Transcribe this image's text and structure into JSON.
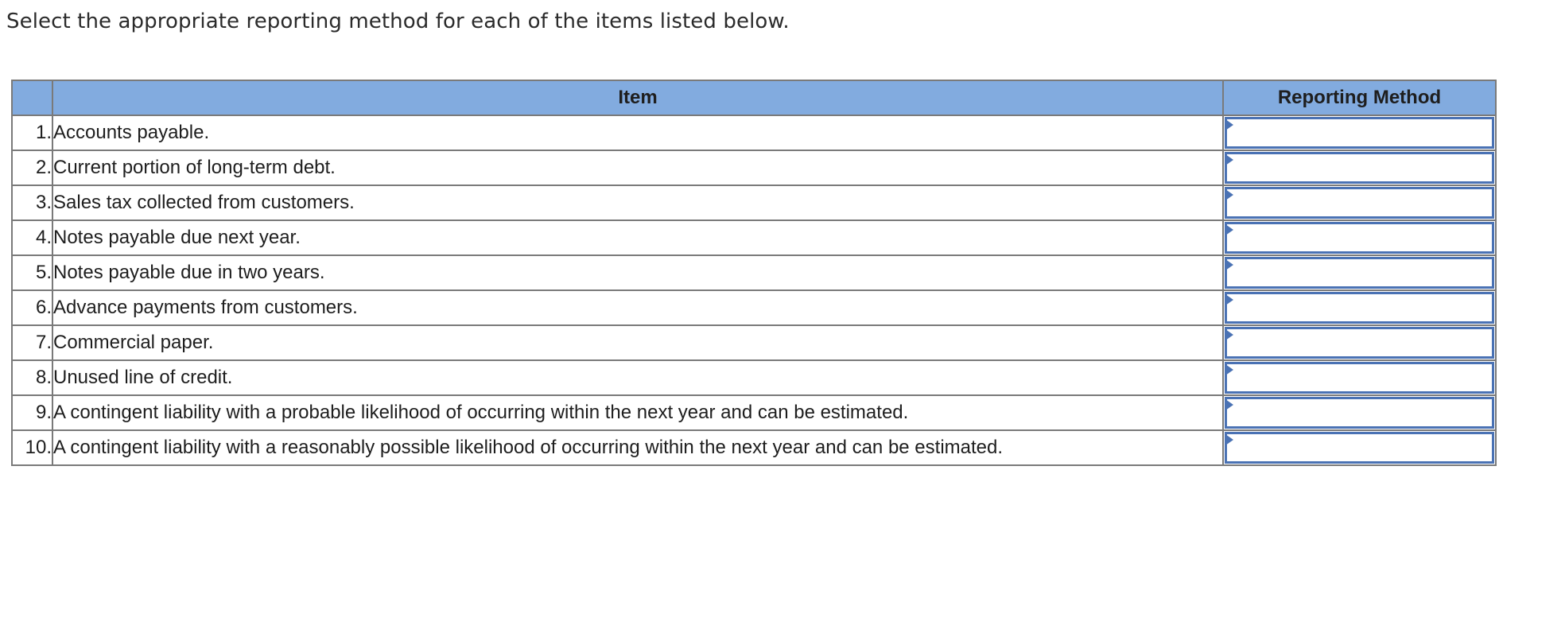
{
  "prompt": "Select the appropriate reporting method for each of the items listed below.",
  "table": {
    "headers": {
      "number": "",
      "item": "Item",
      "method": "Reporting Method"
    },
    "rows": [
      {
        "number": "1.",
        "item": "Accounts payable.",
        "method": ""
      },
      {
        "number": "2.",
        "item": "Current portion of long-term debt.",
        "method": ""
      },
      {
        "number": "3.",
        "item": "Sales tax collected from customers.",
        "method": ""
      },
      {
        "number": "4.",
        "item": "Notes payable due next year.",
        "method": ""
      },
      {
        "number": "5.",
        "item": "Notes payable due in two years.",
        "method": ""
      },
      {
        "number": "6.",
        "item": "Advance payments from customers.",
        "method": ""
      },
      {
        "number": "7.",
        "item": "Commercial paper.",
        "method": ""
      },
      {
        "number": "8.",
        "item": "Unused line of credit.",
        "method": ""
      },
      {
        "number": "9.",
        "item": "A contingent liability with a probable likelihood of occurring within the next year and can be estimated.",
        "method": ""
      },
      {
        "number": "10.",
        "item": "A contingent liability with a reasonably possible likelihood of occurring within the next year and can be estimated.",
        "method": ""
      }
    ]
  },
  "colors": {
    "header_bg": "#82abdf",
    "border": "#7a7a7a",
    "dropdown_accent": "#4a72b4"
  }
}
